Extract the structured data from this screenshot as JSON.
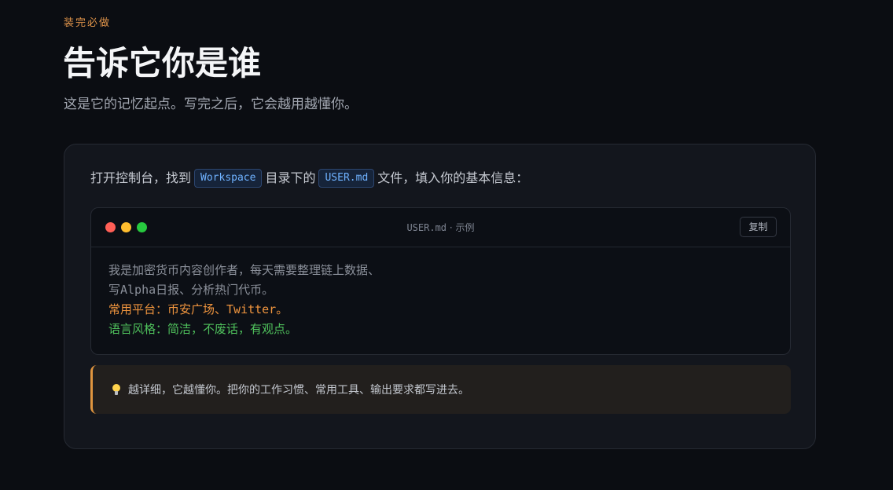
{
  "header": {
    "eyebrow": "装完必做",
    "title": "告诉它你是谁",
    "subtitle": "这是它的记忆起点。写完之后，它会越用越懂你。"
  },
  "instruction": {
    "text_before": "打开控制台，找到",
    "chip_workspace": "Workspace",
    "text_middle": "目录下的",
    "chip_file": "USER.md",
    "text_after": "文件，填入你的基本信息："
  },
  "editor": {
    "file_name": "USER.md",
    "separator": "·",
    "file_suffix": "示例",
    "copy_label": "复制",
    "lines": [
      "我是加密货币内容创作者，每天需要整理链上数据、",
      "写Alpha日报、分析热门代币。",
      "常用平台：币安广场、Twitter。",
      "语言风格：简洁，不废话，有观点。"
    ],
    "colors": {
      "muted": "#8b909a",
      "orange": "#f0953e",
      "green": "#4fc15c"
    },
    "window_dots": [
      "#ff5f56",
      "#ffbd2e",
      "#27c93f"
    ]
  },
  "tip": {
    "icon": "lightbulb-icon",
    "text": "越详细，它越懂你。把你的工作习惯、常用工具、输出要求都写进去。"
  },
  "theme": {
    "accent": "#e0944a",
    "background": "#0b0d12",
    "card": "#13161d",
    "chip_text": "#6fb2ff"
  }
}
